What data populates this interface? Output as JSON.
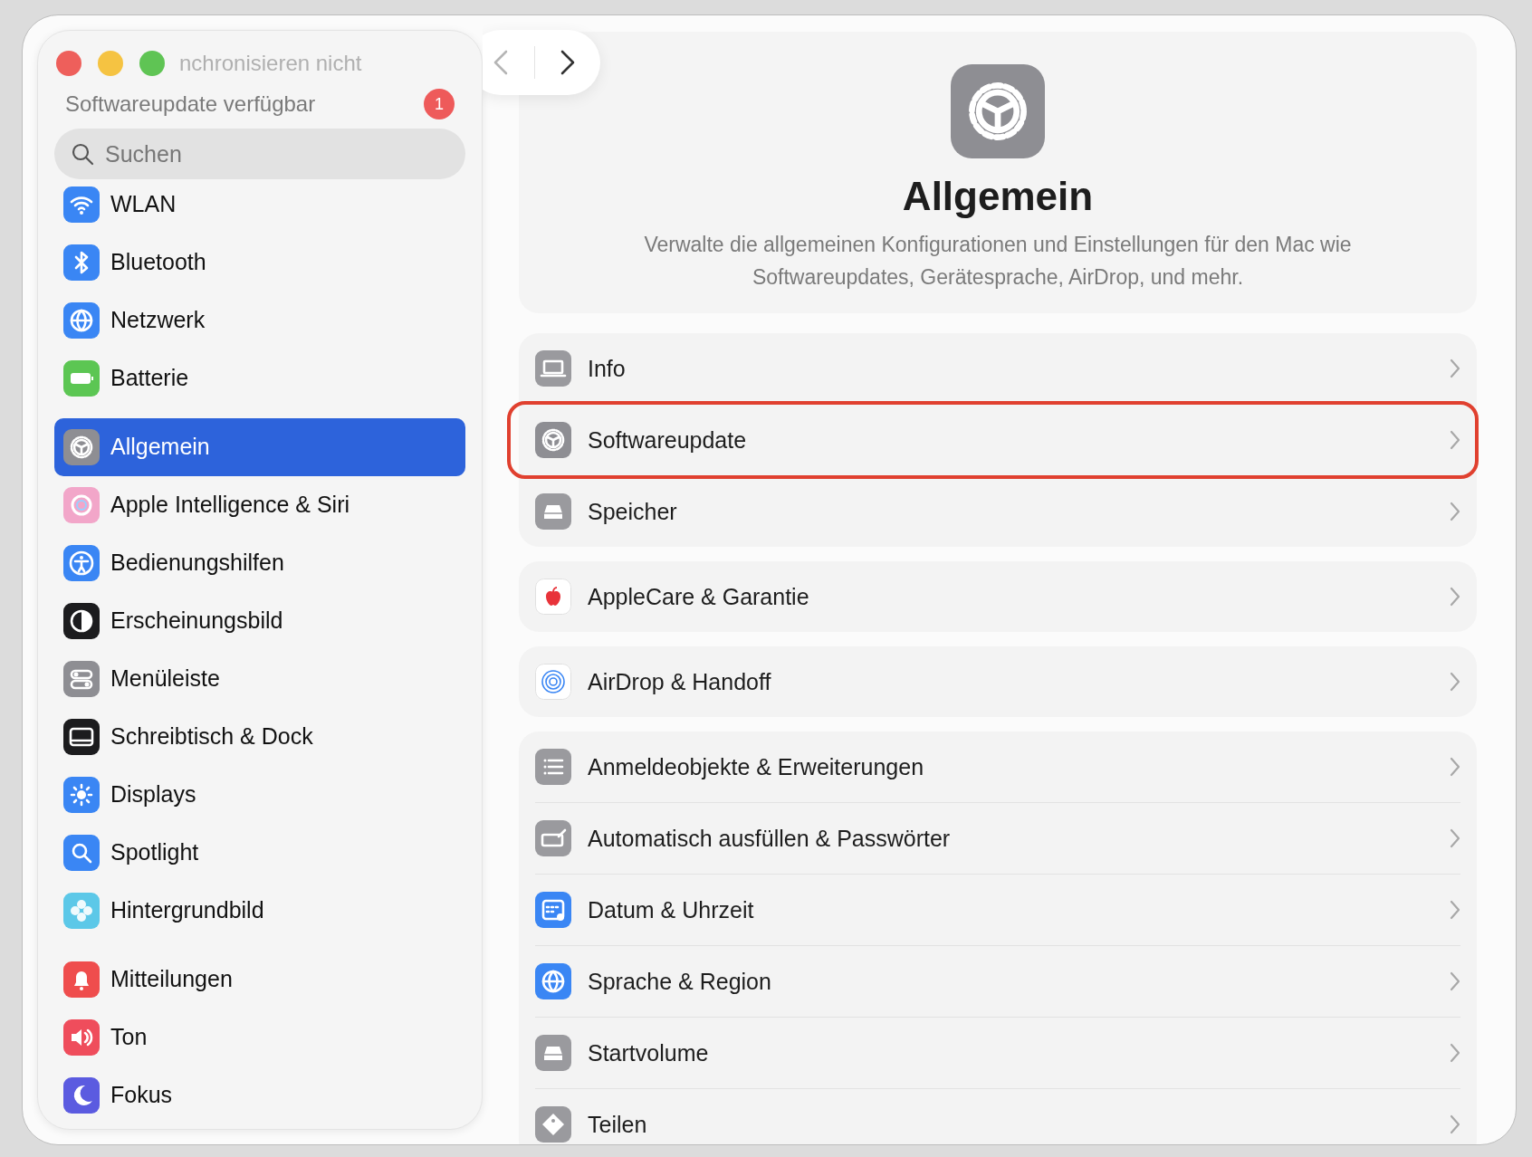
{
  "sidebar": {
    "notices": [
      {
        "text": "nchronisieren nicht",
        "faded": true
      },
      {
        "text": "Softwareupdate verfügbar",
        "faded": false,
        "badge": "1"
      }
    ],
    "search": {
      "placeholder": "Suchen"
    },
    "groups": [
      {
        "items": [
          {
            "label": "WLAN",
            "selected": false
          },
          {
            "label": "Bluetooth",
            "selected": false
          },
          {
            "label": "Netzwerk",
            "selected": false
          },
          {
            "label": "Batterie",
            "selected": false
          }
        ]
      },
      {
        "items": [
          {
            "label": "Allgemein",
            "selected": true
          },
          {
            "label": "Apple Intelligence & Siri",
            "selected": false
          },
          {
            "label": "Bedienungshilfen",
            "selected": false
          },
          {
            "label": "Erscheinungsbild",
            "selected": false
          },
          {
            "label": "Menüleiste",
            "selected": false
          },
          {
            "label": "Schreibtisch & Dock",
            "selected": false
          },
          {
            "label": "Displays",
            "selected": false
          },
          {
            "label": "Spotlight",
            "selected": false
          },
          {
            "label": "Hintergrundbild",
            "selected": false
          }
        ]
      },
      {
        "items": [
          {
            "label": "Mitteilungen",
            "selected": false
          },
          {
            "label": "Ton",
            "selected": false
          },
          {
            "label": "Fokus",
            "selected": false
          }
        ]
      }
    ]
  },
  "navigation": {
    "back": {
      "disabled": true
    },
    "forward": {
      "disabled": false
    }
  },
  "header": {
    "title": "Allgemein",
    "description": "Verwalte die allgemeinen Konfigurationen und Einstellungen für den Mac wie Softwareupdates, Gerätesprache, AirDrop, und mehr."
  },
  "groups": [
    {
      "rows": [
        {
          "label": "Info",
          "highlighted": false
        },
        {
          "label": "Softwareupdate",
          "highlighted": true
        },
        {
          "label": "Speicher",
          "highlighted": false
        }
      ]
    },
    {
      "rows": [
        {
          "label": "AppleCare & Garantie",
          "highlighted": false
        }
      ]
    },
    {
      "rows": [
        {
          "label": "AirDrop & Handoff",
          "highlighted": false
        }
      ]
    },
    {
      "rows": [
        {
          "label": "Anmeldeobjekte & Erweiterungen",
          "highlighted": false
        },
        {
          "label": "Automatisch ausfüllen & Passwörter",
          "highlighted": false
        },
        {
          "label": "Datum & Uhrzeit",
          "highlighted": false
        },
        {
          "label": "Sprache & Region",
          "highlighted": false
        },
        {
          "label": "Startvolume",
          "highlighted": false
        },
        {
          "label": "Teilen",
          "highlighted": false
        }
      ]
    }
  ]
}
